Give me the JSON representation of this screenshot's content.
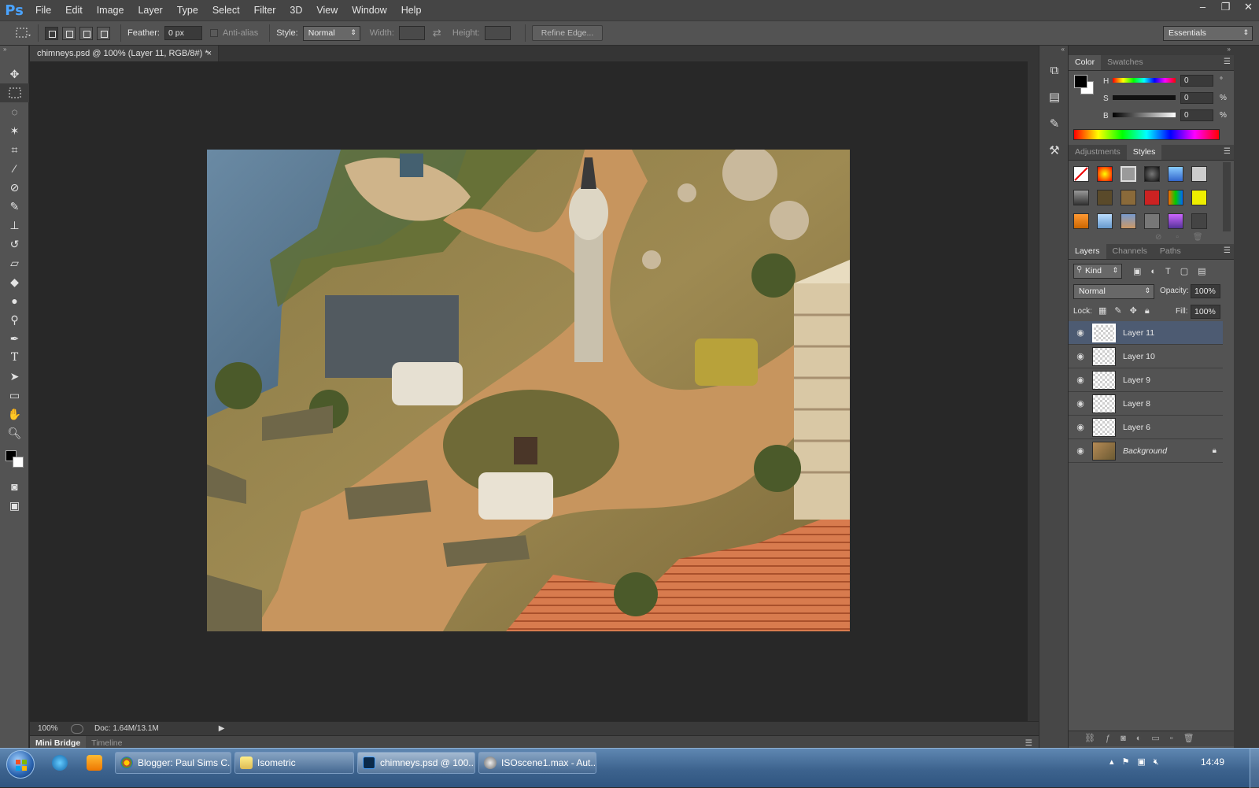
{
  "app": {
    "logo": "Ps"
  },
  "menu": [
    "File",
    "Edit",
    "Image",
    "Layer",
    "Type",
    "Select",
    "Filter",
    "3D",
    "View",
    "Window",
    "Help"
  ],
  "window_controls": {
    "minimize": "–",
    "restore": "❐",
    "close": "✕"
  },
  "options": {
    "feather_label": "Feather:",
    "feather_value": "0 px",
    "anti_alias_label": "Anti-alias",
    "style_label": "Style:",
    "style_value": "Normal",
    "width_label": "Width:",
    "height_label": "Height:",
    "refine_edge": "Refine Edge...",
    "workspace": "Essentials"
  },
  "document": {
    "tab_title": "chimneys.psd @ 100% (Layer 11, RGB/8#) *",
    "close": "×",
    "zoom": "100%",
    "doc_size": "Doc: 1.64M/13.1M"
  },
  "bottom_tabs": [
    "Mini Bridge",
    "Timeline"
  ],
  "color_panel": {
    "tabs": [
      "Color",
      "Swatches"
    ],
    "h_label": "H",
    "h_value": "0",
    "h_unit": "°",
    "s_label": "S",
    "s_value": "0",
    "s_unit": "%",
    "b_label": "B",
    "b_value": "0",
    "b_unit": "%",
    "foreground": "#000000",
    "background": "#ffffff"
  },
  "styles_panel": {
    "tabs": [
      "Adjustments",
      "Styles"
    ]
  },
  "layers_panel": {
    "tabs": [
      "Layers",
      "Channels",
      "Paths"
    ],
    "filter_kind": "Kind",
    "blend_mode": "Normal",
    "opacity_label": "Opacity:",
    "opacity_value": "100%",
    "lock_label": "Lock:",
    "fill_label": "Fill:",
    "fill_value": "100%",
    "layers": [
      {
        "name": "Layer 11"
      },
      {
        "name": "Layer 10"
      },
      {
        "name": "Layer 9"
      },
      {
        "name": "Layer 8"
      },
      {
        "name": "Layer 6"
      },
      {
        "name": "Background"
      }
    ]
  },
  "taskbar": {
    "buttons": [
      {
        "label": "Blogger: Paul Sims C..."
      },
      {
        "label": "Isometric"
      },
      {
        "label": "chimneys.psd @ 100..."
      },
      {
        "label": "ISOscene1.max - Aut..."
      }
    ],
    "clock": "14:49"
  },
  "colors": {
    "accent_blue": "#4aa3ff",
    "selected_layer": "#4d5b72"
  }
}
